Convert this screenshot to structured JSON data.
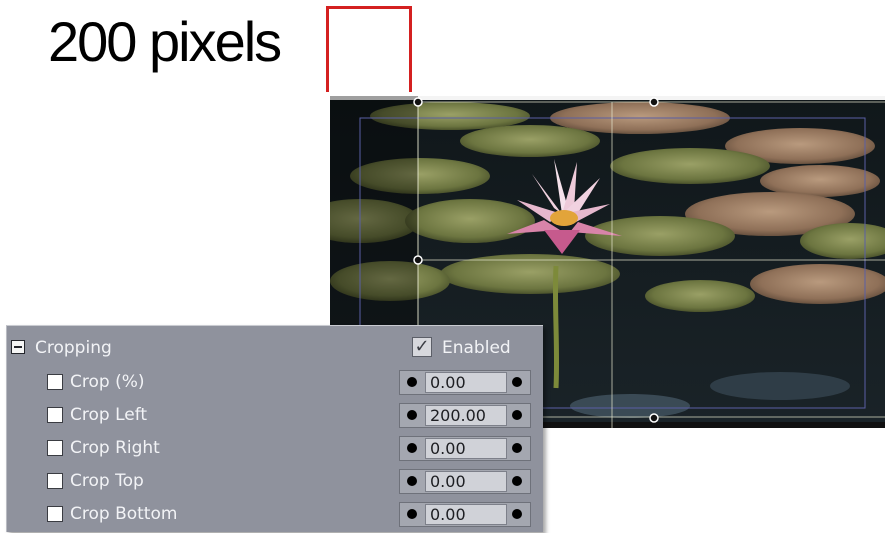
{
  "annotation": {
    "title": "200 pixels",
    "marker_color": "#d42020"
  },
  "preview": {
    "content": "water lily photo with crop handles"
  },
  "panel": {
    "section_label": "Cropping",
    "enabled_label": "Enabled",
    "enabled_checked": true,
    "rows": [
      {
        "label": "Crop (%)",
        "value": "0.00"
      },
      {
        "label": "Crop Left",
        "value": "200.00"
      },
      {
        "label": "Crop Right",
        "value": "0.00"
      },
      {
        "label": "Crop Top",
        "value": "0.00"
      },
      {
        "label": "Crop Bottom",
        "value": "0.00"
      }
    ],
    "colors": {
      "panel_bg": "#8f929d",
      "field_bg": "#d0d2d8",
      "text": "#f2f3f6"
    }
  }
}
